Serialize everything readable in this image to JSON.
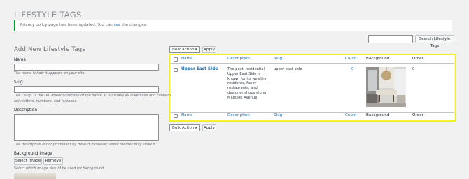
{
  "page": {
    "title": "LIFESTYLE TAGS",
    "notice": {
      "text_before": "Privacy policy page has been updated. You can ",
      "link": "see",
      "text_after": " the changes."
    },
    "search_button": "Search Lifestyle Tags"
  },
  "form": {
    "heading": "Add New Lifestyle Tags",
    "name_label": "Name",
    "name_value": "",
    "name_help": "The name is how it appears on your site.",
    "slug_label": "Slug",
    "slug_value": "",
    "slug_help_1": "The “slug” is the URL-friendly version of the name. It is usually all lowercase and contains",
    "slug_help_2": "only letters, numbers, and hyphens.",
    "description_label": "Description",
    "description_value": "",
    "description_help": "The description is not prominent by default; however, some themes may show it.",
    "bg_label": "Background Image",
    "select_image": "Select Image",
    "remove": "Remove",
    "bg_help": "Select which image should be used for background."
  },
  "bulk": {
    "selected": "Bulk Actions",
    "apply": "Apply"
  },
  "table": {
    "columns": {
      "name": "Name",
      "description": "Description",
      "slug": "Slug",
      "count": "Count",
      "background": "Background",
      "order": "Order"
    },
    "row": {
      "name": "Upper East Side",
      "description_lines": [
        "The post, residential",
        "Upper East Side is",
        "known for its wealthy",
        "residents, fancy",
        "restaurants, and",
        "designer shops along",
        "Madison Avenue"
      ],
      "slug": "upper-east-side",
      "count": "0",
      "order": "0"
    }
  },
  "colors": {
    "link": "#2271b1",
    "highlight": "#f4ef2c",
    "notice_border": "#00a32a"
  }
}
